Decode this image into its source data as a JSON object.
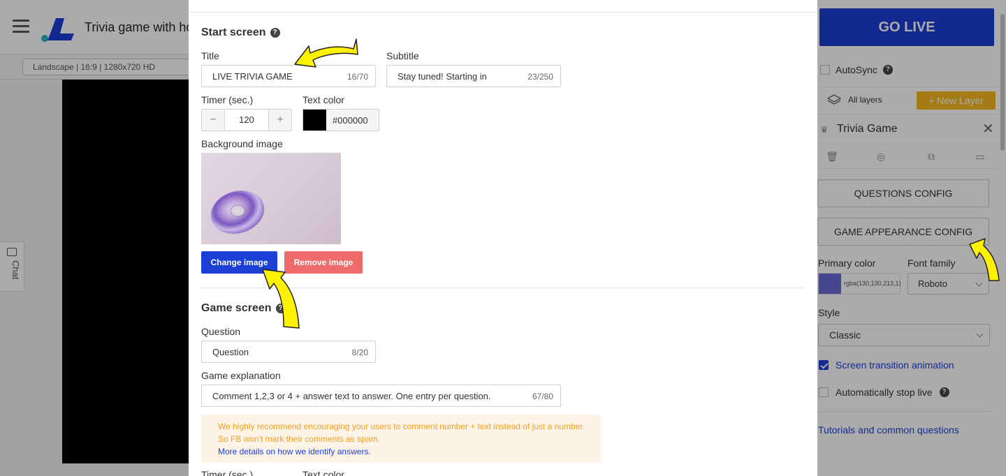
{
  "app": {
    "title": "Trivia game with ho",
    "preset": "Landscape | 16:9 | 1280x720 HD",
    "chat_label": "Chat"
  },
  "right_panel": {
    "go_live": "GO LIVE",
    "autosync": "AutoSync",
    "all_layers": "All layers",
    "new_layer": "New Layer",
    "layer_title": "Trivia Game",
    "questions_config": "QUESTIONS CONFIG",
    "appearance_config": "GAME APPEARANCE CONFIG",
    "primary_color_label": "Primary color",
    "primary_color_value": "rgba(130,130,213,1)",
    "font_family_label": "Font family",
    "font_family_value": "Roboto",
    "style_label": "Style",
    "style_value": "Classic",
    "transition_label": "Screen transition animation",
    "transition_checked": true,
    "auto_stop_label": "Automatically stop live",
    "auto_stop_checked": false,
    "tutorials_link": "Tutorials and common questions"
  },
  "modal": {
    "start_screen": {
      "heading": "Start screen",
      "title_label": "Title",
      "title_value": "LIVE TRIVIA GAME",
      "title_count": "16/70",
      "subtitle_label": "Subtitle",
      "subtitle_value": "Stay tuned! Starting in",
      "subtitle_count": "23/250",
      "timer_label": "Timer (sec.)",
      "timer_value": "120",
      "text_color_label": "Text color",
      "text_color_value": "#000000",
      "bg_image_label": "Background image",
      "change_image": "Change image",
      "remove_image": "Remove image"
    },
    "game_screen": {
      "heading": "Game screen",
      "question_label": "Question",
      "question_value": "Question",
      "question_count": "8/20",
      "explanation_label": "Game explanation",
      "explanation_value": "Comment 1,2,3 or 4 + answer text to answer. One entry per question.",
      "explanation_count": "67/80",
      "warning_line1": "We highly recommend encouraging your users to comment number + text instead of just a number.",
      "warning_line2": "So FB won't mark their comments as spam.",
      "warning_link": "More details on how we identify answers.",
      "timer_label": "Timer (sec.)",
      "text_color_label": "Text color"
    }
  },
  "colors": {
    "accent": "#1c3fd6",
    "danger": "#ee6b6b",
    "warning_bg": "#fdf3e6",
    "warning_text": "#f0a020",
    "new_layer": "#f5b820"
  }
}
